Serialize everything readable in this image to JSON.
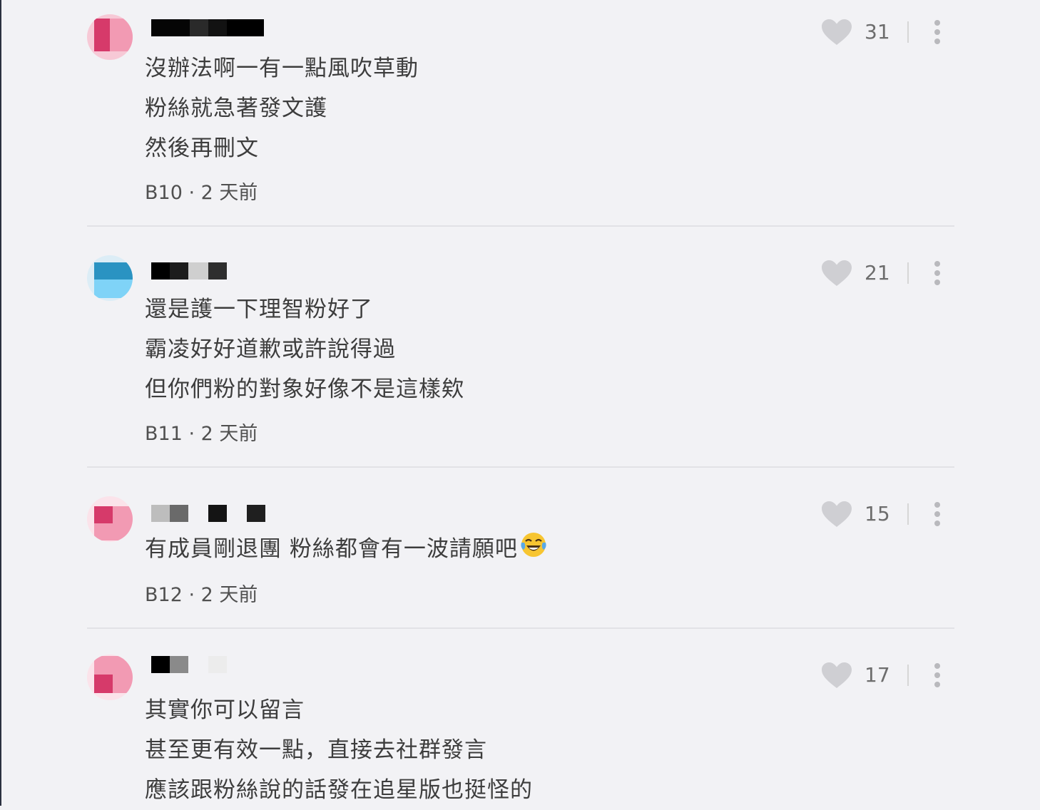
{
  "comments": [
    {
      "lines": [
        "沒辦法啊一有一點風吹草動",
        "粉絲就急著發文護",
        "然後再刪文"
      ],
      "floor": "B10",
      "time": "2 天前",
      "likes": "31"
    },
    {
      "lines": [
        "還是護一下理智粉好了",
        "霸凌好好道歉或許說得過",
        "但你們粉的對象好像不是這樣欸"
      ],
      "floor": "B11",
      "time": "2 天前",
      "likes": "21"
    },
    {
      "lines": [
        "有成員剛退團 粉絲都會有一波請願吧"
      ],
      "emoji": "face-with-tears-of-joy",
      "floor": "B12",
      "time": "2 天前",
      "likes": "15"
    },
    {
      "lines": [
        "其實你可以留言",
        "甚至更有效一點，直接去社群發言",
        "應該跟粉絲說的話發在追星版也挺怪的"
      ],
      "likes": "17"
    }
  ],
  "icons": {
    "like": "heart-icon",
    "more": "more-vertical-icon"
  },
  "colors": {
    "background": "#f2f2f5",
    "heart": "#cfcfd3",
    "text": "#3d3d3d",
    "divider": "#e2e2e6"
  }
}
